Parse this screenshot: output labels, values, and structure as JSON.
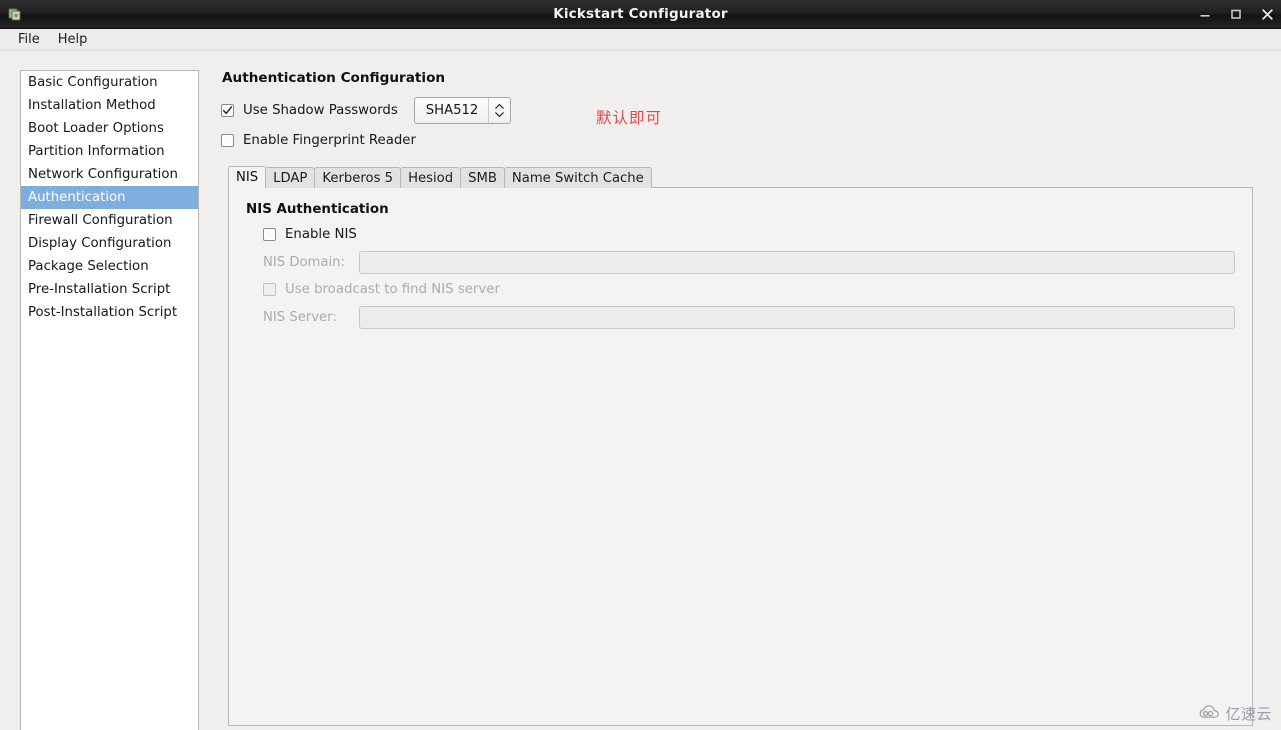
{
  "window": {
    "title": "Kickstart Configurator",
    "icon": "app-icon",
    "buttons": [
      {
        "name": "minimize",
        "glyph": "minimize-icon"
      },
      {
        "name": "maximize",
        "glyph": "maximize-icon"
      },
      {
        "name": "close",
        "glyph": "close-icon"
      }
    ]
  },
  "menubar": {
    "items": [
      {
        "label": "File"
      },
      {
        "label": "Help"
      }
    ]
  },
  "sidebar": {
    "items": [
      {
        "label": "Basic Configuration",
        "selected": false
      },
      {
        "label": "Installation Method",
        "selected": false
      },
      {
        "label": "Boot Loader Options",
        "selected": false
      },
      {
        "label": "Partition Information",
        "selected": false
      },
      {
        "label": "Network Configuration",
        "selected": false
      },
      {
        "label": "Authentication",
        "selected": true
      },
      {
        "label": "Firewall Configuration",
        "selected": false
      },
      {
        "label": "Display Configuration",
        "selected": false
      },
      {
        "label": "Package Selection",
        "selected": false
      },
      {
        "label": "Pre-Installation Script",
        "selected": false
      },
      {
        "label": "Post-Installation Script",
        "selected": false
      }
    ],
    "selected_color": "#7eaedd"
  },
  "main": {
    "page_title": "Authentication Configuration",
    "shadow_passwords": {
      "label": "Use Shadow Passwords",
      "checked": true
    },
    "hash_combo": {
      "value": "SHA512"
    },
    "fingerprint": {
      "label": "Enable Fingerprint Reader",
      "checked": false
    },
    "annotation": {
      "text": "默认即可",
      "color": "#e04a4a"
    },
    "tabs": [
      {
        "label": "NIS",
        "active": true
      },
      {
        "label": "LDAP",
        "active": false
      },
      {
        "label": "Kerberos 5",
        "active": false
      },
      {
        "label": "Hesiod",
        "active": false
      },
      {
        "label": "SMB",
        "active": false
      },
      {
        "label": "Name Switch Cache",
        "active": false
      }
    ],
    "nis_panel": {
      "title": "NIS Authentication",
      "enable": {
        "label": "Enable NIS",
        "checked": false
      },
      "domain": {
        "label": "NIS Domain:",
        "value": "",
        "disabled": true
      },
      "broadcast": {
        "label": "Use broadcast to find NIS server",
        "checked": false,
        "disabled": true
      },
      "server": {
        "label": "NIS Server:",
        "value": "",
        "disabled": true
      }
    }
  },
  "watermark": {
    "text": "亿速云"
  }
}
